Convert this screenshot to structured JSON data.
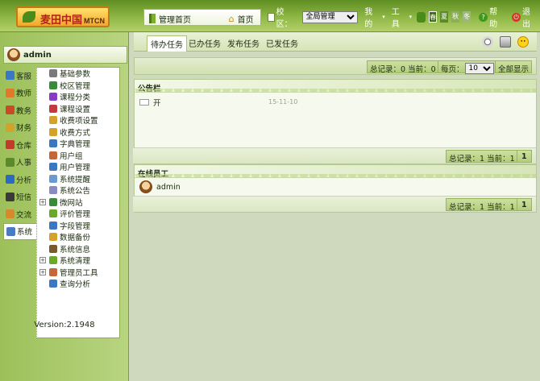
{
  "header": {
    "logo_text": "麦田中国",
    "logo_sub": "MTCN",
    "active_tab": "管理首页",
    "home_link": "首页",
    "campus_label": "校区：",
    "campus_value": "全局管理",
    "my_menu": "我的",
    "tools_menu": "工具",
    "season_labels": [
      "春",
      "夏",
      "秋",
      "冬"
    ],
    "help": "帮助",
    "exit": "退出"
  },
  "user": {
    "name": "admin"
  },
  "modules": [
    {
      "label": "客服",
      "icon": "book-icon",
      "color": "#3a78c4"
    },
    {
      "label": "教师",
      "icon": "teacher-icon",
      "color": "#e07a2a"
    },
    {
      "label": "教务",
      "icon": "books-icon",
      "color": "#c94a2a"
    },
    {
      "label": "财务",
      "icon": "money-icon",
      "color": "#d4a12a"
    },
    {
      "label": "仓库",
      "icon": "house-icon",
      "color": "#c23a2a"
    },
    {
      "label": "人事",
      "icon": "person-icon",
      "color": "#5a8a2a"
    },
    {
      "label": "分析",
      "icon": "chart-icon",
      "color": "#2a6ac4"
    },
    {
      "label": "短信",
      "icon": "phone-icon",
      "color": "#3a3a3a"
    },
    {
      "label": "交流",
      "icon": "chat-icon",
      "color": "#d88a2a"
    },
    {
      "label": "系统",
      "icon": "system-icon",
      "color": "#4a7ac4"
    }
  ],
  "system_menu": [
    {
      "label": "基础参数",
      "icon": "gear-icon",
      "color": "#7a7a7a",
      "expandable": false
    },
    {
      "label": "校区管理",
      "icon": "globe-icon",
      "color": "#3a8a3a",
      "expandable": false
    },
    {
      "label": "课程分类",
      "icon": "book-icon",
      "color": "#8a3ac4",
      "expandable": false
    },
    {
      "label": "课程设置",
      "icon": "books-icon",
      "color": "#c43a3a",
      "expandable": false
    },
    {
      "label": "收费项设置",
      "icon": "money-icon",
      "color": "#d4a12a",
      "expandable": false
    },
    {
      "label": "收费方式",
      "icon": "folder-icon",
      "color": "#d4a12a",
      "expandable": false
    },
    {
      "label": "字典管理",
      "icon": "dictionary-icon",
      "color": "#3a78c4",
      "expandable": false
    },
    {
      "label": "用户组",
      "icon": "group-icon",
      "color": "#c4683a",
      "expandable": false
    },
    {
      "label": "用户管理",
      "icon": "user-icon",
      "color": "#3a78c4",
      "expandable": false
    },
    {
      "label": "系统提醒",
      "icon": "speaker-icon",
      "color": "#6a9ad4",
      "expandable": false
    },
    {
      "label": "系统公告",
      "icon": "mail-icon",
      "color": "#8a8ac4",
      "expandable": false
    },
    {
      "label": "微网站",
      "icon": "globe-icon",
      "color": "#3a8a3a",
      "expandable": true
    },
    {
      "label": "评价管理",
      "icon": "star-icon",
      "color": "#6aa82a",
      "expandable": false
    },
    {
      "label": "字段管理",
      "icon": "field-icon",
      "color": "#3a78c4",
      "expandable": false
    },
    {
      "label": "数据备份",
      "icon": "database-icon",
      "color": "#d4a12a",
      "expandable": false
    },
    {
      "label": "系统信息",
      "icon": "info-icon",
      "color": "#7a5a2a",
      "expandable": false
    },
    {
      "label": "系统清理",
      "icon": "broom-icon",
      "color": "#6aa82a",
      "expandable": true
    },
    {
      "label": "管理员工具",
      "icon": "tools-icon",
      "color": "#c4683a",
      "expandable": true
    },
    {
      "label": "查询分析",
      "icon": "search-icon",
      "color": "#3a78c4",
      "expandable": false
    }
  ],
  "version": "Version:2.1948",
  "task_tabs": [
    "待办任务",
    "已办任务",
    "发布任务",
    "已发任务"
  ],
  "pager": {
    "total_text": "总记录：0 当前：0",
    "page_size_label": "每页：",
    "page_size": "10",
    "show_all": "全部显示"
  },
  "notice_panel": {
    "title": "公告栏",
    "rows": [
      {
        "title": "开",
        "date": "15-11-10"
      }
    ],
    "footer_text": "总记录：1 当前：1",
    "page": "1"
  },
  "online_panel": {
    "title": "在线员工",
    "rows": [
      {
        "name": "admin"
      }
    ],
    "footer_text": "总记录：1 当前：1",
    "page": "1"
  }
}
